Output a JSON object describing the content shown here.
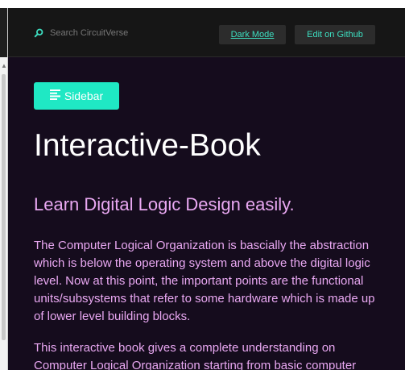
{
  "header": {
    "search": {
      "placeholder": "Search CircuitVerse",
      "icon": "search-icon"
    },
    "dark_mode_label": "Dark Mode",
    "github_label": "Edit on Github"
  },
  "main": {
    "sidebar_label": "Sidebar",
    "sidebar_icon": "menu-lines-icon",
    "title": "Interactive-Book",
    "subtitle": "Learn Digital Logic Design easily.",
    "paragraphs": [
      "The Computer Logical Organization is bascially the abstraction which is below the operating system and above the digital logic level. Now at this point, the important points are the functional units/subsystems that refer to some hardware which is made up of lower level building blocks.",
      "This interactive book gives a complete understanding on Computer Logical Organization starting from basic computer"
    ]
  },
  "colors": {
    "accent": "#1fe8c4",
    "link_text": "#3ddec0",
    "body_text": "#e9a8f2",
    "content_background": "#150c1d",
    "header_background": "#161616"
  }
}
